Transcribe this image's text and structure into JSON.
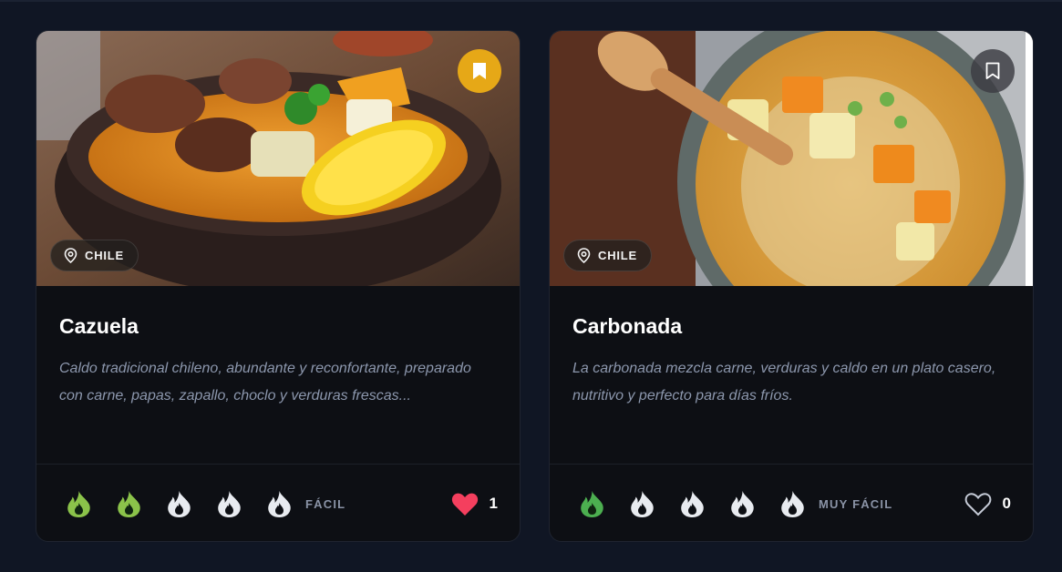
{
  "cards": [
    {
      "title": "Cazuela",
      "description": "Caldo tradicional chileno, abundante y reconfortante, preparado con carne, papas, zapallo, choclo y verduras frescas...",
      "location": "CHILE",
      "location_icon": "map-pin-icon",
      "bookmarked": true,
      "bookmark_color": "#e6a817",
      "difficulty_level": 2,
      "difficulty_max": 5,
      "difficulty_label": "FÁCIL",
      "difficulty_color": "#8bc34a",
      "liked": true,
      "like_color": "#f43f5e",
      "likes": "1",
      "image_subject": "cazuela stew in clay pot"
    },
    {
      "title": "Carbonada",
      "description": "La carbonada mezcla carne, verduras y caldo en un plato casero, nutritivo y perfecto para días fríos.",
      "location": "CHILE",
      "location_icon": "map-pin-icon",
      "bookmarked": false,
      "bookmark_color": "#3c3c42",
      "difficulty_level": 1,
      "difficulty_max": 5,
      "difficulty_label": "MUY FÁCIL",
      "difficulty_color": "#4caf50",
      "liked": false,
      "like_color": "#c4cad6",
      "likes": "0",
      "image_subject": "carbonada soup with wooden spoon"
    }
  ],
  "colors": {
    "background": "#101624",
    "card": "#0d0f14",
    "inactive_flame": "#e8ebf0"
  }
}
